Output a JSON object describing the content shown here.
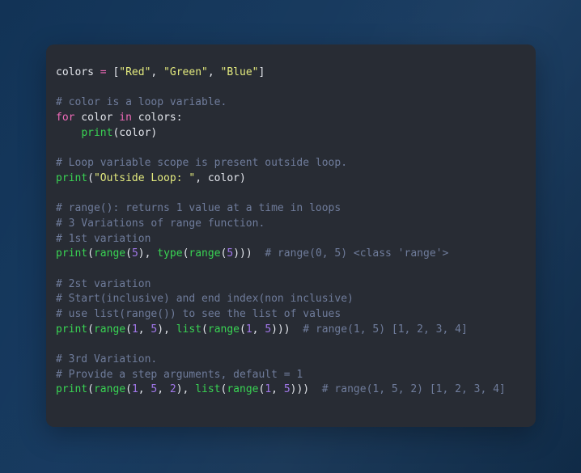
{
  "window": {
    "background_color": "#13365b",
    "gradient_from": "#123356",
    "gradient_to": "#102b47"
  },
  "code_card": {
    "background_color": "#282c34",
    "language": "python",
    "corner_radius_px": 10,
    "palette": {
      "plain": "#e3e6ec",
      "comment": "#6f7c9b",
      "keyword": "#ef6ab8",
      "operator": "#ef6ab8",
      "string": "#e3ea7e",
      "builtin": "#39d353",
      "number": "#a077e8"
    },
    "lines": [
      {
        "n": 1,
        "text": "colors = [\"Red\", \"Green\", \"Blue\"]",
        "tokens": [
          {
            "t": "colors ",
            "c": "plain"
          },
          {
            "t": "=",
            "c": "operator"
          },
          {
            "t": " [",
            "c": "punct"
          },
          {
            "t": "\"Red\"",
            "c": "string"
          },
          {
            "t": ", ",
            "c": "punct"
          },
          {
            "t": "\"Green\"",
            "c": "string"
          },
          {
            "t": ", ",
            "c": "punct"
          },
          {
            "t": "\"Blue\"",
            "c": "string"
          },
          {
            "t": "]",
            "c": "punct"
          }
        ]
      },
      {
        "n": 2,
        "text": "",
        "tokens": []
      },
      {
        "n": 3,
        "text": "# color is a loop variable.",
        "tokens": [
          {
            "t": "# color is a loop variable.",
            "c": "comment"
          }
        ]
      },
      {
        "n": 4,
        "text": "for color in colors:",
        "tokens": [
          {
            "t": "for",
            "c": "keyword"
          },
          {
            "t": " color ",
            "c": "plain"
          },
          {
            "t": "in",
            "c": "keyword"
          },
          {
            "t": " colors:",
            "c": "plain"
          }
        ]
      },
      {
        "n": 5,
        "text": "    print(color)",
        "tokens": [
          {
            "t": "    ",
            "c": "plain"
          },
          {
            "t": "print",
            "c": "builtin"
          },
          {
            "t": "(color)",
            "c": "punct"
          }
        ]
      },
      {
        "n": 6,
        "text": "",
        "tokens": []
      },
      {
        "n": 7,
        "text": "# Loop variable scope is present outside loop.",
        "tokens": [
          {
            "t": "# Loop variable scope is present outside loop.",
            "c": "comment"
          }
        ]
      },
      {
        "n": 8,
        "text": "print(\"Outside Loop: \", color)",
        "tokens": [
          {
            "t": "print",
            "c": "builtin"
          },
          {
            "t": "(",
            "c": "punct"
          },
          {
            "t": "\"Outside Loop: \"",
            "c": "string"
          },
          {
            "t": ", color)",
            "c": "punct"
          }
        ]
      },
      {
        "n": 9,
        "text": "",
        "tokens": []
      },
      {
        "n": 10,
        "text": "# range(): returns 1 value at a time in loops",
        "tokens": [
          {
            "t": "# range(): returns 1 value at a time in loops",
            "c": "comment"
          }
        ]
      },
      {
        "n": 11,
        "text": "# 3 Variations of range function.",
        "tokens": [
          {
            "t": "# 3 Variations of range function.",
            "c": "comment"
          }
        ]
      },
      {
        "n": 12,
        "text": "# 1st variation",
        "tokens": [
          {
            "t": "# 1st variation",
            "c": "comment"
          }
        ]
      },
      {
        "n": 13,
        "text": "print(range(5), type(range(5)))  # range(0, 5) <class 'range'>",
        "tokens": [
          {
            "t": "print",
            "c": "builtin"
          },
          {
            "t": "(",
            "c": "punct"
          },
          {
            "t": "range",
            "c": "builtin"
          },
          {
            "t": "(",
            "c": "punct"
          },
          {
            "t": "5",
            "c": "number"
          },
          {
            "t": "), ",
            "c": "punct"
          },
          {
            "t": "type",
            "c": "builtin"
          },
          {
            "t": "(",
            "c": "punct"
          },
          {
            "t": "range",
            "c": "builtin"
          },
          {
            "t": "(",
            "c": "punct"
          },
          {
            "t": "5",
            "c": "number"
          },
          {
            "t": ")))",
            "c": "punct"
          },
          {
            "t": "  # range(0, 5) <class 'range'>",
            "c": "comment"
          }
        ]
      },
      {
        "n": 14,
        "text": "",
        "tokens": []
      },
      {
        "n": 15,
        "text": "# 2st variation",
        "tokens": [
          {
            "t": "# 2st variation",
            "c": "comment"
          }
        ]
      },
      {
        "n": 16,
        "text": "# Start(inclusive) and end index(non inclusive)",
        "tokens": [
          {
            "t": "# Start(inclusive) and end index(non inclusive)",
            "c": "comment"
          }
        ]
      },
      {
        "n": 17,
        "text": "# use list(range()) to see the list of values",
        "tokens": [
          {
            "t": "# use list(range()) to see the list of values",
            "c": "comment"
          }
        ]
      },
      {
        "n": 18,
        "text": "print(range(1, 5), list(range(1, 5)))  # range(1, 5) [1, 2, 3, 4]",
        "tokens": [
          {
            "t": "print",
            "c": "builtin"
          },
          {
            "t": "(",
            "c": "punct"
          },
          {
            "t": "range",
            "c": "builtin"
          },
          {
            "t": "(",
            "c": "punct"
          },
          {
            "t": "1",
            "c": "number"
          },
          {
            "t": ", ",
            "c": "punct"
          },
          {
            "t": "5",
            "c": "number"
          },
          {
            "t": "), ",
            "c": "punct"
          },
          {
            "t": "list",
            "c": "builtin"
          },
          {
            "t": "(",
            "c": "punct"
          },
          {
            "t": "range",
            "c": "builtin"
          },
          {
            "t": "(",
            "c": "punct"
          },
          {
            "t": "1",
            "c": "number"
          },
          {
            "t": ", ",
            "c": "punct"
          },
          {
            "t": "5",
            "c": "number"
          },
          {
            "t": ")))",
            "c": "punct"
          },
          {
            "t": "  # range(1, 5) [1, 2, 3, 4]",
            "c": "comment"
          }
        ]
      },
      {
        "n": 19,
        "text": "",
        "tokens": []
      },
      {
        "n": 20,
        "text": "# 3rd Variation.",
        "tokens": [
          {
            "t": "# 3rd Variation.",
            "c": "comment"
          }
        ]
      },
      {
        "n": 21,
        "text": "# Provide a step arguments, default = 1",
        "tokens": [
          {
            "t": "# Provide a step arguments, default = 1",
            "c": "comment"
          }
        ]
      },
      {
        "n": 22,
        "text": "print(range(1, 5, 2), list(range(1, 5)))  # range(1, 5, 2) [1, 2, 3, 4]",
        "tokens": [
          {
            "t": "print",
            "c": "builtin"
          },
          {
            "t": "(",
            "c": "punct"
          },
          {
            "t": "range",
            "c": "builtin"
          },
          {
            "t": "(",
            "c": "punct"
          },
          {
            "t": "1",
            "c": "number"
          },
          {
            "t": ", ",
            "c": "punct"
          },
          {
            "t": "5",
            "c": "number"
          },
          {
            "t": ", ",
            "c": "punct"
          },
          {
            "t": "2",
            "c": "number"
          },
          {
            "t": "), ",
            "c": "punct"
          },
          {
            "t": "list",
            "c": "builtin"
          },
          {
            "t": "(",
            "c": "punct"
          },
          {
            "t": "range",
            "c": "builtin"
          },
          {
            "t": "(",
            "c": "punct"
          },
          {
            "t": "1",
            "c": "number"
          },
          {
            "t": ", ",
            "c": "punct"
          },
          {
            "t": "5",
            "c": "number"
          },
          {
            "t": ")))",
            "c": "punct"
          },
          {
            "t": "  # range(1, 5, 2) [1, 2, 3, 4]",
            "c": "comment"
          }
        ]
      }
    ]
  }
}
